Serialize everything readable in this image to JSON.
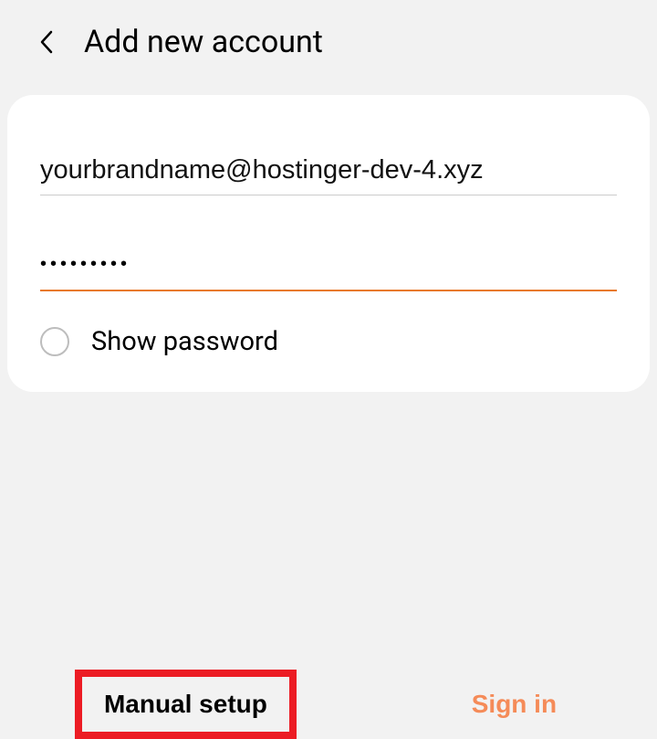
{
  "header": {
    "title": "Add new account"
  },
  "form": {
    "email_value": "yourbrandname@hostinger-dev-4.xyz",
    "password_value": "•••••••••",
    "show_password_label": "Show password"
  },
  "actions": {
    "manual_setup_label": "Manual setup",
    "signin_label": "Sign in"
  },
  "colors": {
    "accent": "#e8792a",
    "highlight_border": "#ec1c24",
    "signin_text": "#f58b58"
  }
}
